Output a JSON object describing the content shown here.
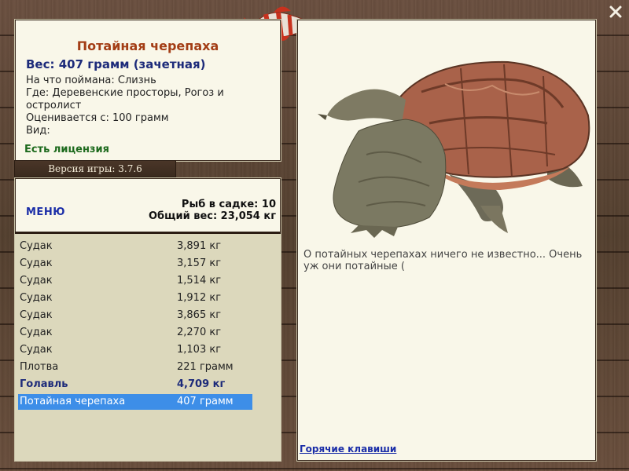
{
  "fish": {
    "name": "Потайная черепаха",
    "weight_line": "Вес: 407 грамм (зачетная)",
    "caught_on": "На что поймана: Слизнь",
    "where": "Где: Деревенские просторы, Рогоз и",
    "where_cont": "остролист",
    "valued_from": "Оценивается с: 100 грамм",
    "species": "Вид:",
    "license": "Есть лицензия",
    "description": "О потайных черепахах ничего не известно... Очень уж они потайные ("
  },
  "version": "Версия игры: 3.7.6",
  "cage": {
    "menu_label": "МЕНЮ",
    "count_line": "Рыб в садке: 10",
    "total_line": "Общий вес: 23,054 кг",
    "items": [
      {
        "name": "Судак",
        "weight": "3,891 кг"
      },
      {
        "name": "Судак",
        "weight": "3,157 кг"
      },
      {
        "name": "Судак",
        "weight": "1,514 кг"
      },
      {
        "name": "Судак",
        "weight": "1,912 кг"
      },
      {
        "name": "Судак",
        "weight": "3,865 кг"
      },
      {
        "name": "Судак",
        "weight": "2,270 кг"
      },
      {
        "name": "Судак",
        "weight": "1,103 кг"
      },
      {
        "name": "Плотва",
        "weight": "221 грамм"
      },
      {
        "name": "Голавль",
        "weight": "4,709 кг"
      },
      {
        "name": "Потайная черепаха",
        "weight": "407 грамм"
      }
    ]
  },
  "hotkeys_label": "Горячие клавиши",
  "icons": {
    "close": "close-icon",
    "logo": "fish-logo-icon"
  },
  "colors": {
    "title": "#a33d15",
    "weight": "#1d2b7a",
    "license": "#1d6a1d",
    "link": "#1b2ea8",
    "selection": "#3d8ee8"
  }
}
